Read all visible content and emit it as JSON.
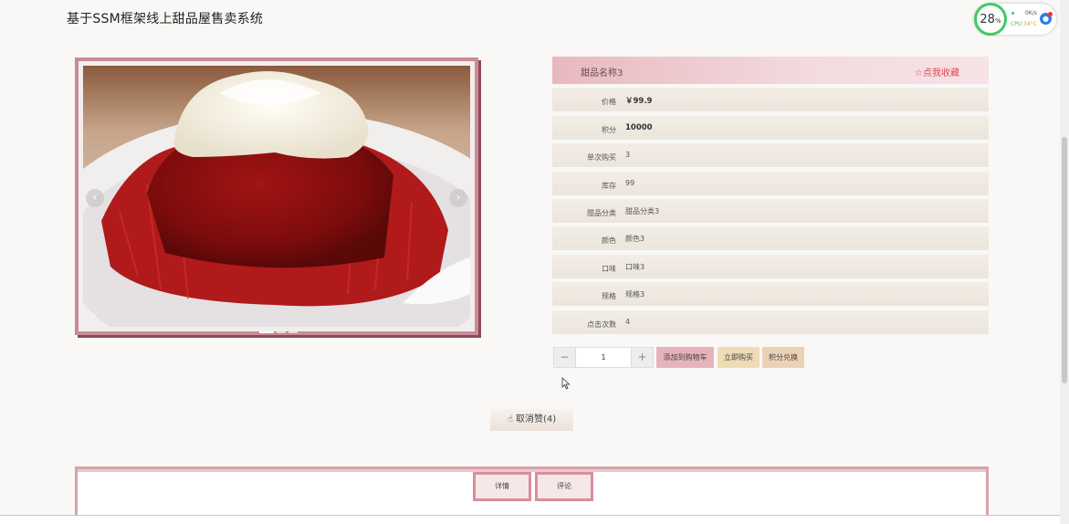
{
  "app": {
    "title": "基于SSM框架线上甜品屋售卖系统"
  },
  "perf": {
    "percent": "28",
    "percent_unit": "%",
    "net": "0K/s",
    "cpu_label": "CPU",
    "cpu_temp": "34°C"
  },
  "carousel": {
    "prev": "‹",
    "next": "›",
    "slides": 3,
    "active_slide": 1
  },
  "product": {
    "name": "甜品名称3",
    "favorite_label": "☆点我收藏",
    "fields": [
      {
        "label": "价格",
        "value": "￥99.9"
      },
      {
        "label": "积分",
        "value": "10000"
      },
      {
        "label": "单次购买",
        "value": "3"
      },
      {
        "label": "库存",
        "value": "99"
      },
      {
        "label": "甜品分类",
        "value": "甜品分类3"
      },
      {
        "label": "颜色",
        "value": "颜色3"
      },
      {
        "label": "口味",
        "value": "口味3"
      },
      {
        "label": "规格",
        "value": "规格3"
      },
      {
        "label": "点击次数",
        "value": "4"
      }
    ]
  },
  "actions": {
    "minus": "−",
    "quantity": "1",
    "plus": "+",
    "add_to_cart": "添加到购物车",
    "buy_now": "立即购买",
    "redeem_points": "积分兑换"
  },
  "like": {
    "thumb": "👍",
    "label": "取消赞(4)"
  },
  "tabs": {
    "details": "详情",
    "comments": "评论"
  }
}
